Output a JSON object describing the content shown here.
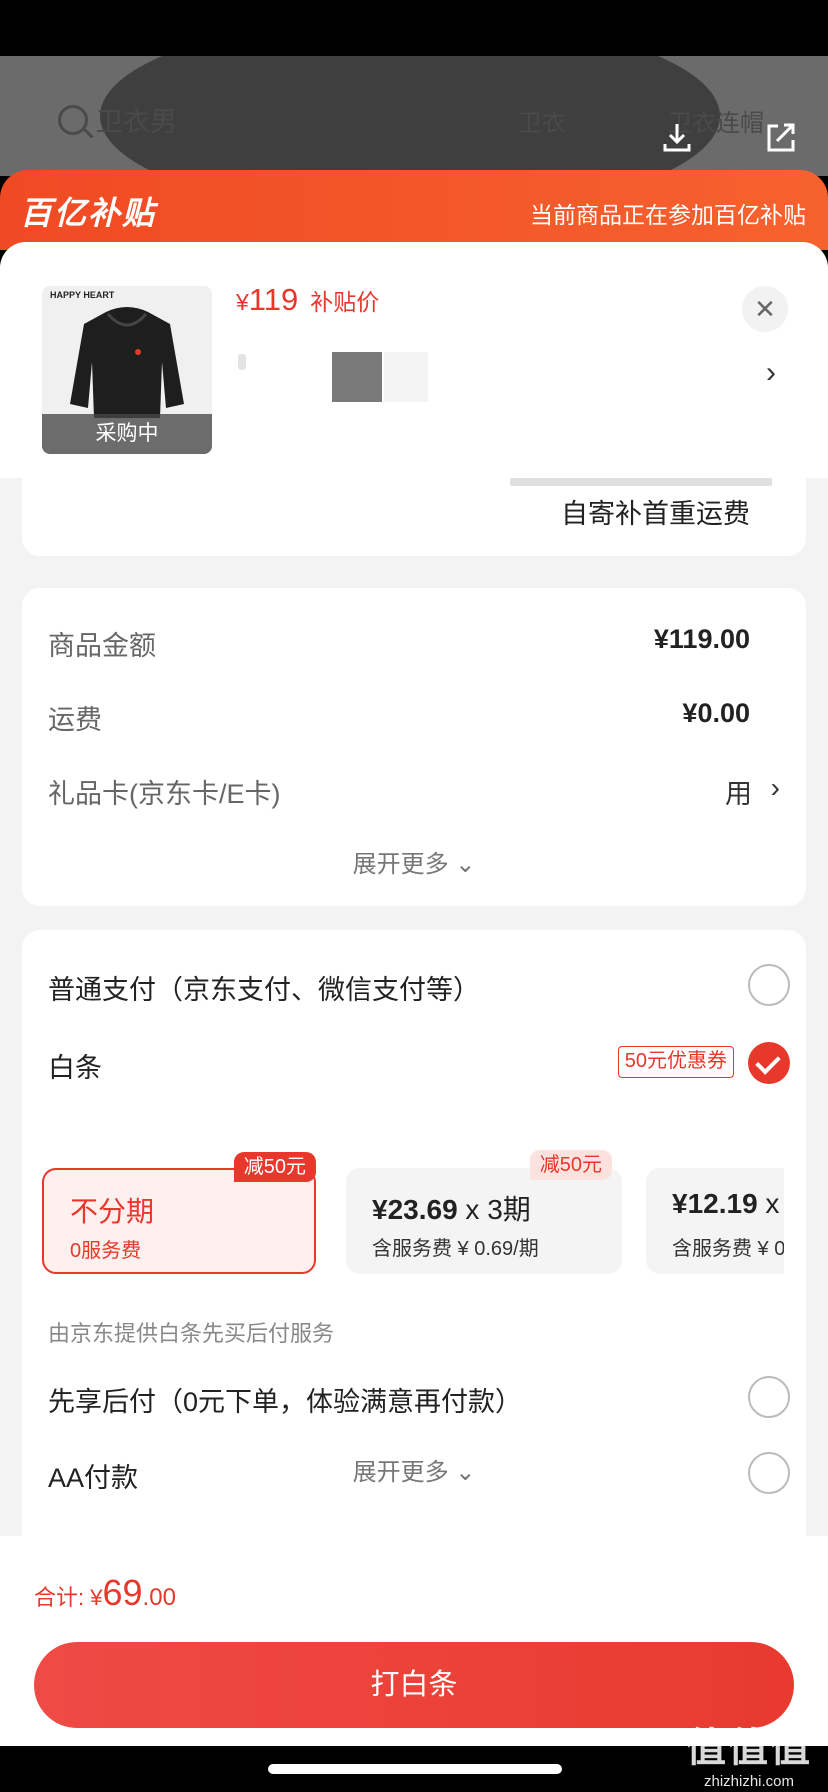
{
  "background": {
    "search_text": "卫衣男",
    "tabs": [
      "卫衣",
      "卫衣连帽"
    ]
  },
  "banner": {
    "logo": "百亿补贴",
    "tip": "当前商品正在参加百亿补贴"
  },
  "product": {
    "thumb_brand": "HAPPY HEART",
    "thumb_label": "采购中",
    "price_symbol": "¥",
    "price_value": "119",
    "price_tag": "补贴价"
  },
  "delivery": {
    "text": "自寄补首重运费"
  },
  "fees": {
    "rows": [
      {
        "label": "商品金额",
        "value": "¥119.00"
      },
      {
        "label": "运费",
        "value": "¥0.00"
      },
      {
        "label": "礼品卡(京东卡/E卡)",
        "value": "用"
      }
    ],
    "expand": "展开更多"
  },
  "payment": {
    "normal": "普通支付（京东支付、微信支付等）",
    "baitiao": "白条",
    "coupon": "50元优惠券",
    "plans": [
      {
        "title": "不分期",
        "sub": "0服务费",
        "tag": "减50元"
      },
      {
        "title_amount": "¥23.69",
        "title_x": "x",
        "title_period": "3期",
        "sub": "含服务费 ¥ 0.69/期",
        "tag": "减50元"
      },
      {
        "title_amount": "¥12.19",
        "title_x": "x",
        "sub": "含服务费 ¥ 0"
      }
    ],
    "note": "由京东提供白条先买后付服务",
    "pay_later": "先享后付（0元下单，体验满意再付款）",
    "aa": "AA付款",
    "expand": "展开更多"
  },
  "footer": {
    "total_label": "合计:",
    "total_symbol": "¥",
    "total_int": "69",
    "total_dec": ".00",
    "button": "打白条"
  },
  "watermark": {
    "big": "值值值",
    "small": "zhizhizhi.com"
  },
  "colors": {
    "accent": "#e8372b",
    "banner": "#f04a24"
  }
}
